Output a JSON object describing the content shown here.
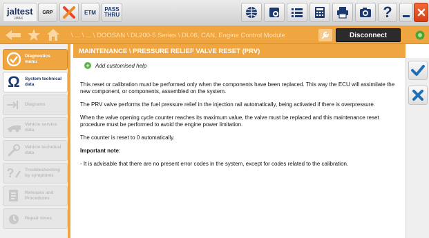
{
  "toolbar": {
    "logo_text": "jaltest",
    "logo_sub": "JMAX",
    "grp_label": "GRP",
    "etm_label": "ETM",
    "pass_line1": "PASS",
    "pass_line2": "THRU"
  },
  "navbar": {
    "breadcrumb": "\\ ... \\ ... \\ DOOSAN \\ DL200-5 Series \\ DL06, CAN, Engine Control Module",
    "disconnect_label": "Disconnect"
  },
  "sidebar": {
    "items": [
      {
        "line1": "Diagnostics",
        "line2": "menu"
      },
      {
        "line1": "System technical",
        "line2": "data"
      },
      {
        "line1": "Diagrams",
        "line2": ""
      },
      {
        "line1": "Vehicle service",
        "line2": "data"
      },
      {
        "line1": "Vehicle technical",
        "line2": "data"
      },
      {
        "line1": "Troubleshooting",
        "line2": "by symptoms"
      },
      {
        "line1": "Releases and",
        "line2": "Procedures"
      },
      {
        "line1": "Repair times",
        "line2": ""
      }
    ]
  },
  "panel": {
    "title": "MAINTENANCE \\ PRESSURE RELIEF VALVE RESET (PRV)",
    "add_help": "Add customised help",
    "paragraphs": [
      "This reset or calibration must be performed only when the components have been replaced. This way the ECU will assimilate the new component, or components, assembled on the system.",
      "The PRV valve performs the fuel pressure relief in the injection rail automatically, being activated if there is overpressure.",
      "When the valve opening cycle counter reaches its maximum value, the valve must be replaced and this maintenance reset procedure must be performed to avoid the engine power limitation.",
      "The counter is reset to 0 automatically."
    ],
    "note_title": "Important note",
    "note_colon": ":",
    "note_text": "-  It is advisable that there are no present error codes in the system, except for codes related to the calibration."
  },
  "colors": {
    "accent": "#f0a640",
    "navy": "#1d3a70",
    "confirm": "#1e6fb8",
    "close": "#e24a22"
  }
}
